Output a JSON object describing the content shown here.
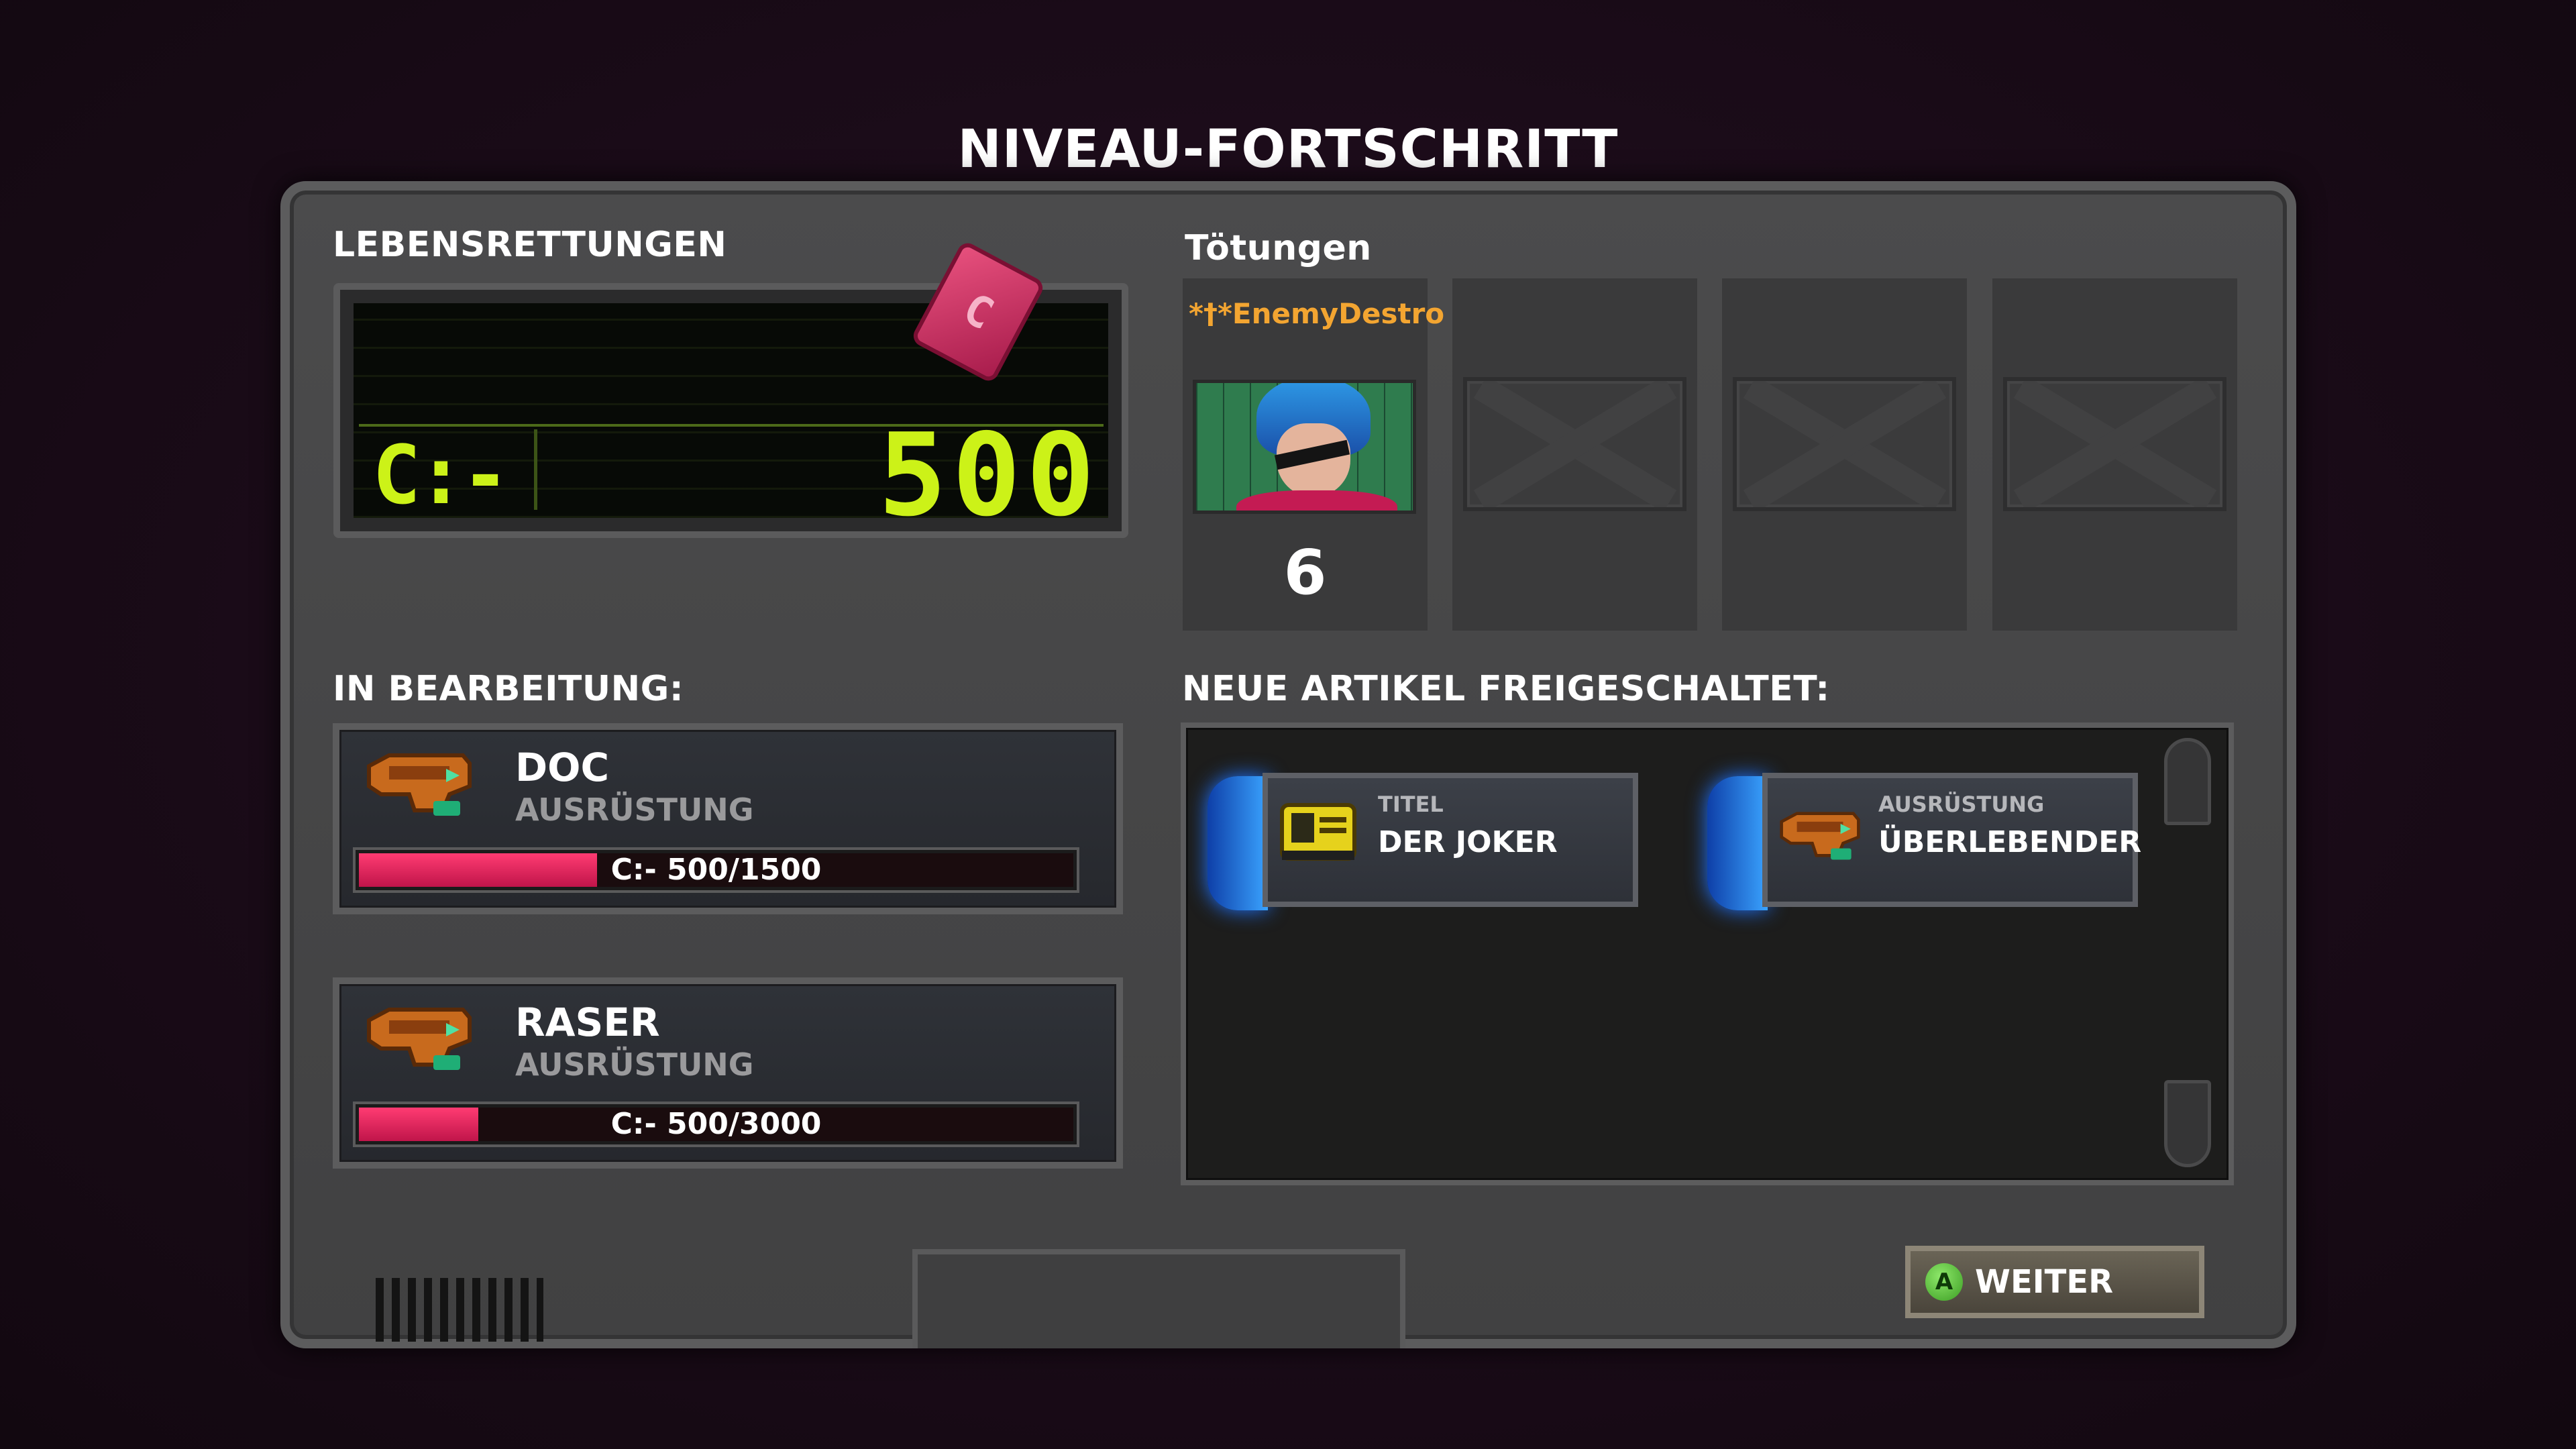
{
  "screen_title": "NIVEAU-FORTSCHRITT",
  "lives_saved": {
    "label": "LEBENSRETTUNGEN",
    "display_logo": "C:-",
    "value": "500"
  },
  "kills": {
    "label": "Tötungen",
    "slots": [
      {
        "player": "*†*EnemyDestro",
        "count": "6",
        "filled": true
      },
      {
        "filled": false
      },
      {
        "filled": false
      },
      {
        "filled": false
      }
    ]
  },
  "in_progress": {
    "label": "IN BEARBEITUNG:",
    "items": [
      {
        "name": "DOC",
        "type": "AUSRÜSTUNG",
        "progress_text": "C:- 500/1500",
        "current": 500,
        "total": 1500
      },
      {
        "name": "RASER",
        "type": "AUSRÜSTUNG",
        "progress_text": "C:- 500/3000",
        "current": 500,
        "total": 3000
      }
    ]
  },
  "unlocked": {
    "label": "NEUE ARTIKEL FREIGESCHALTET:",
    "items": [
      {
        "category": "TITEL",
        "name": "DER JOKER",
        "icon": "title-card-icon"
      },
      {
        "category": "AUSRÜSTUNG",
        "name": "ÜBERLEBENDER",
        "icon": "gear-icon"
      }
    ]
  },
  "continue": {
    "button_glyph": "A",
    "label": "WEITER"
  },
  "colors": {
    "lcd_green": "#ccf218",
    "progress_pink": "#ff3b72",
    "kill_name_orange": "#f3a531",
    "unlock_glow_blue": "#3aa3ff"
  }
}
